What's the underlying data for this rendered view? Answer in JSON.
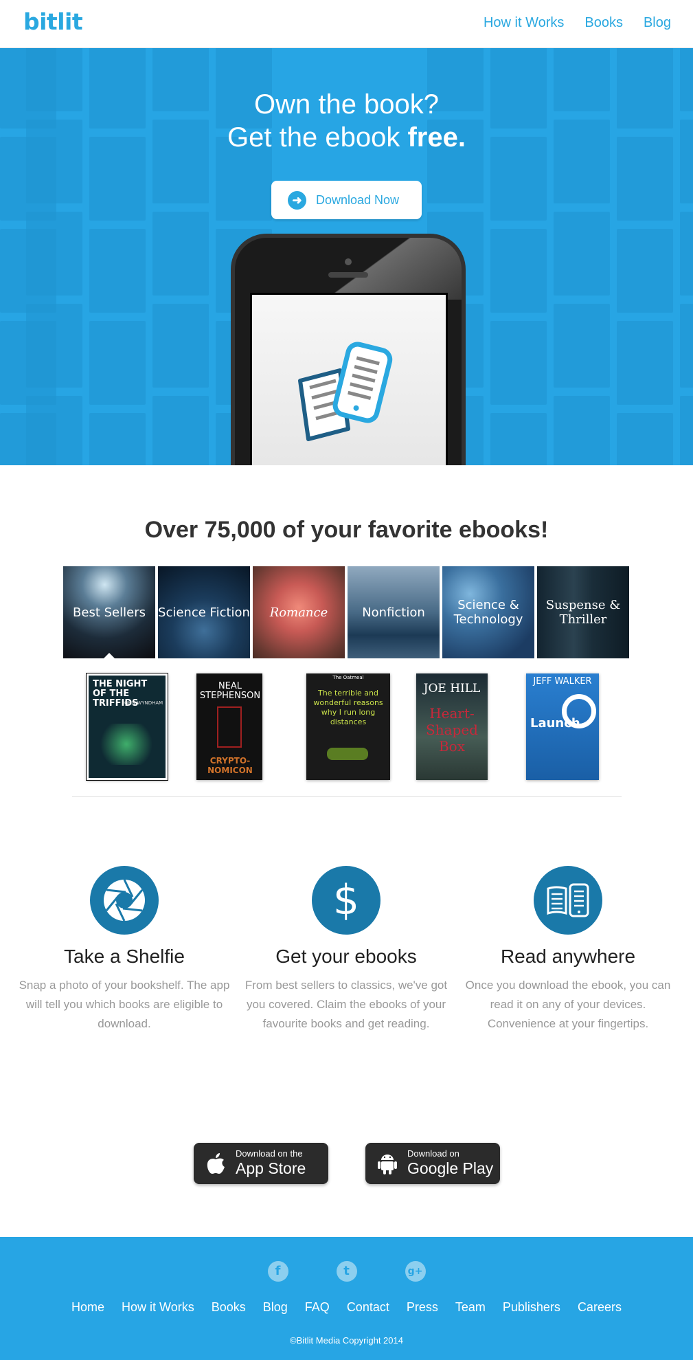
{
  "header": {
    "logo": "bitlit",
    "nav": [
      "How it Works",
      "Books",
      "Blog"
    ]
  },
  "hero": {
    "line1": "Own the book?",
    "line2_prefix": "Get the ebook ",
    "line2_bold": "free.",
    "download_label": "Download Now",
    "download_icon": "arrow-right-circle-icon"
  },
  "ebooks": {
    "title": "Over 75,000 of your favorite ebooks!",
    "categories": [
      {
        "label": "Best Sellers",
        "selected": true
      },
      {
        "label": "Science Fiction"
      },
      {
        "label": "Romance"
      },
      {
        "label": "Nonfiction"
      },
      {
        "label": "Science & Technology"
      },
      {
        "label": "Suspense & Thriller"
      }
    ],
    "covers": [
      {
        "title": "THE NIGHT OF THE TRIFFIDS",
        "author": "JOHN WYNDHAM"
      },
      {
        "title": "CRYPTO-NOMICON",
        "author": "NEAL STEPHENSON"
      },
      {
        "title": "The terrible and wonderful reasons why I run long distances",
        "author": "The Oatmeal"
      },
      {
        "title": "Heart-Shaped Box",
        "author": "JOE HILL"
      },
      {
        "title": "Launch",
        "author": "JEFF WALKER"
      }
    ]
  },
  "features": [
    {
      "icon": "camera-aperture-icon",
      "title": "Take a Shelfie",
      "text": "Snap a photo of your bookshelf. The app will tell you which books are eligible to download."
    },
    {
      "icon": "dollar-icon",
      "title": "Get your ebooks",
      "text": "From best sellers to classics, we've got you covered. Claim the ebooks of your favourite books and get reading."
    },
    {
      "icon": "book-device-icon",
      "title": "Read anywhere",
      "text": "Once you download the ebook, you can read it on any of your devices. Convenience at your fingertips."
    }
  ],
  "stores": {
    "apple": {
      "small": "Download on the",
      "big": "App Store",
      "icon": "apple-icon"
    },
    "google": {
      "small": "Download on",
      "big": "Google Play",
      "icon": "android-icon"
    }
  },
  "footer": {
    "socials": [
      {
        "icon": "facebook-icon",
        "glyph": "f"
      },
      {
        "icon": "twitter-icon",
        "glyph": "t"
      },
      {
        "icon": "google-plus-icon",
        "glyph": "g+"
      }
    ],
    "links": [
      "Home",
      "How it Works",
      "Books",
      "Blog",
      "FAQ",
      "Contact",
      "Press",
      "Team",
      "Publishers",
      "Careers"
    ],
    "copyright": "©Bitlit Media Copyright 2014"
  },
  "colors": {
    "brand": "#2aa8e0",
    "hero_bg": "#27a5e4",
    "feature_icon": "#1a79a9",
    "store_bg": "#2b2b2b"
  }
}
